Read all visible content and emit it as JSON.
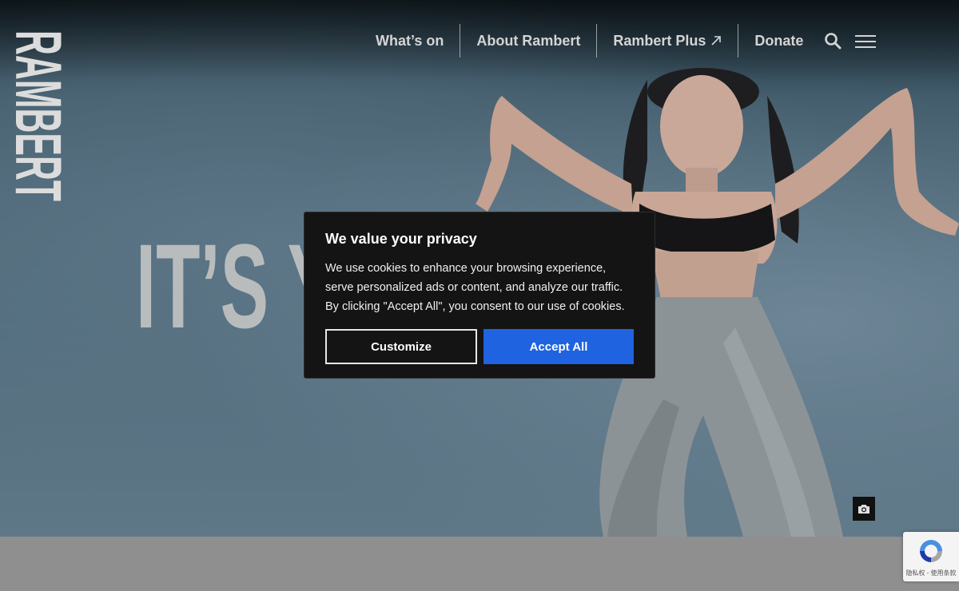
{
  "brand": {
    "logo_text": "RAMBERT"
  },
  "nav": {
    "items": [
      {
        "label": "What’s on"
      },
      {
        "label": "About Rambert"
      },
      {
        "label": "Rambert Plus",
        "icon": "external-arrow-icon"
      },
      {
        "label": "Donate"
      }
    ],
    "search_icon": "search-icon",
    "menu_icon": "hamburger-menu-icon"
  },
  "hero": {
    "headline_visible": "IT’S Y",
    "photo_credit_icon": "camera-icon"
  },
  "cookie_banner": {
    "title": "We value your privacy",
    "lines": [
      "We use cookies to enhance your browsing experience,",
      "serve personalized ads or content, and analyze our traffic.",
      "By clicking \"Accept All\", you consent to our use of cookies."
    ],
    "customize_label": "Customize",
    "accept_label": "Accept All",
    "accept_color": "#1f63e0"
  },
  "recaptcha": {
    "links": "隐私权 - 使用条款"
  }
}
